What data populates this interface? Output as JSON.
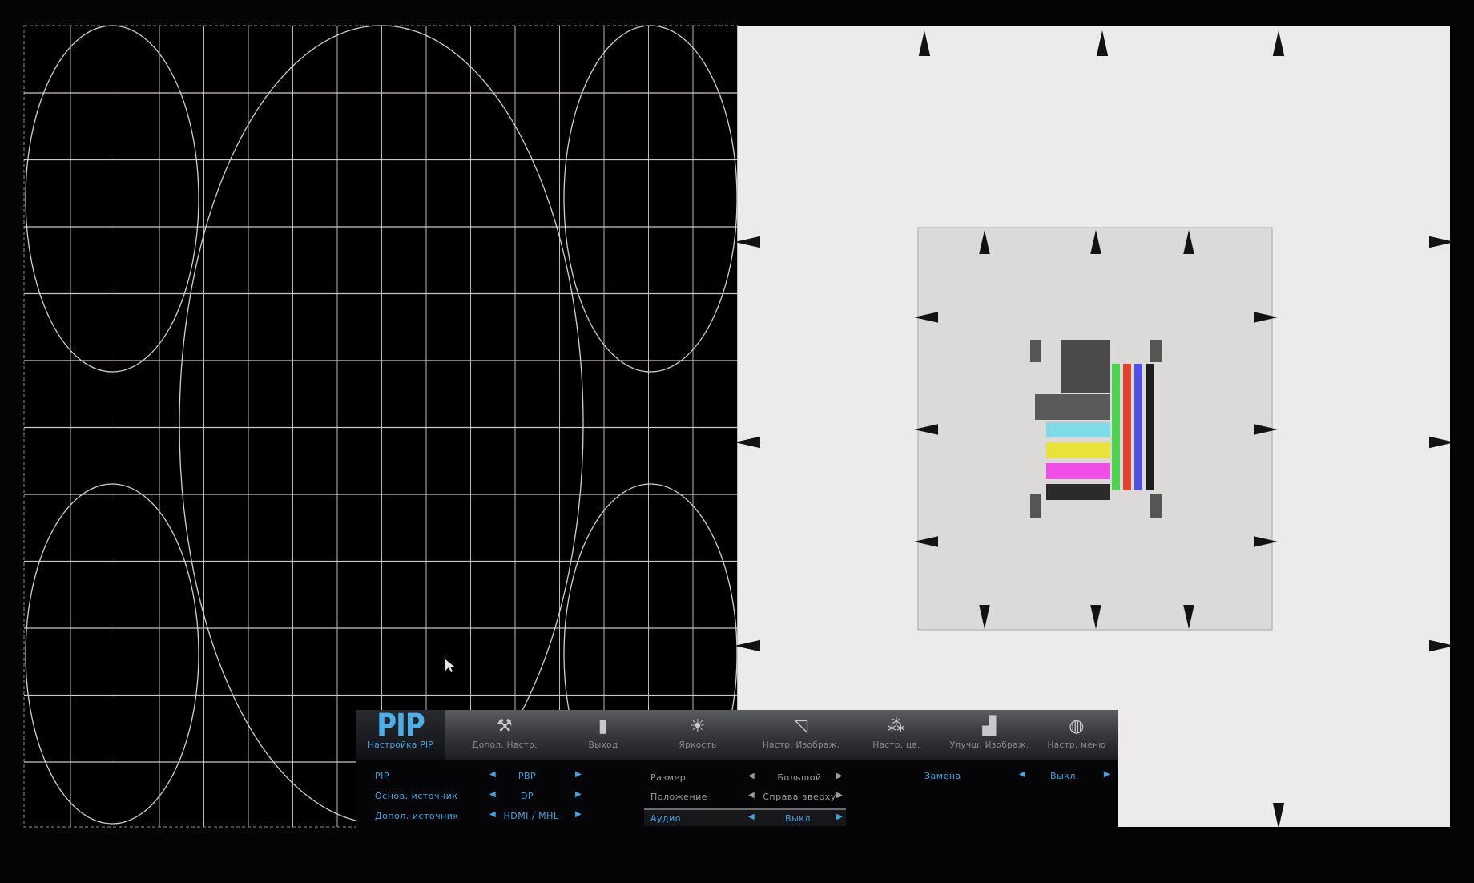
{
  "osd": {
    "tabs": [
      {
        "icon": "pip-logo",
        "big_label": "PIP",
        "label": "Настройка PIP",
        "active": true
      },
      {
        "icon": "tools-icon",
        "label": "Допол. Настр.",
        "active": false
      },
      {
        "icon": "exit-door-icon",
        "label": "Выход",
        "active": false
      },
      {
        "icon": "sun-brightness-icon",
        "label": "Яркость",
        "active": false
      },
      {
        "icon": "picture-adjust-icon",
        "label": "Настр. Изображ.",
        "active": false
      },
      {
        "icon": "color-circles-icon",
        "label": "Настр. цв.",
        "active": false
      },
      {
        "icon": "picture-enhance-icon",
        "label": "Улучш. Изображ.",
        "active": false
      },
      {
        "icon": "menu-globe-icon",
        "label": "Настр. меню",
        "active": false
      }
    ],
    "settings_left": [
      {
        "name": "PIP",
        "value": "PBP"
      },
      {
        "name": "Основ. источник",
        "value": "DP"
      },
      {
        "name": "Допол. источник",
        "value": "HDMI / MHL"
      }
    ],
    "settings_middle": [
      {
        "name": "Размер",
        "value": "Большой"
      },
      {
        "name": "Положение",
        "value": "Справа вверху"
      },
      {
        "name": "Аудио",
        "value": "Выкл.",
        "selected": true
      }
    ],
    "settings_right": [
      {
        "name": "Замена",
        "value": "Выкл."
      }
    ],
    "colors": {
      "accent": "#3aa8e8",
      "inactive": "#9a9ca0"
    }
  }
}
